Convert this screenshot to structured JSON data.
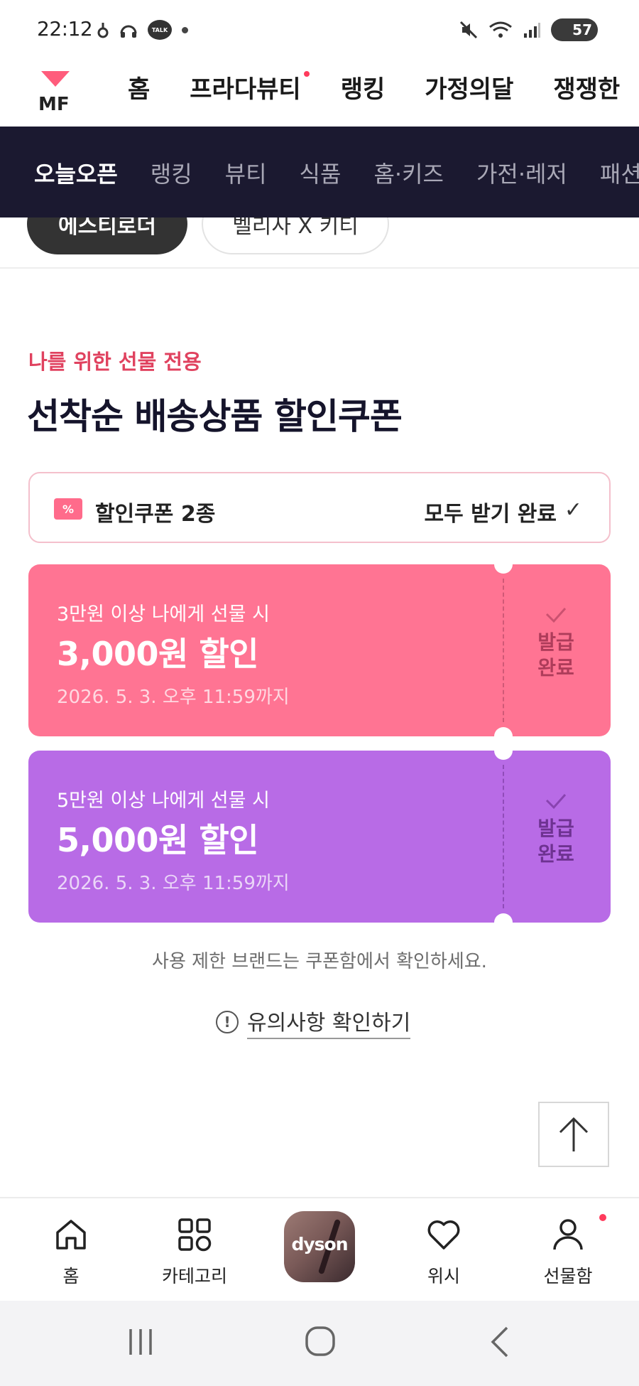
{
  "status_bar": {
    "time": "22:12",
    "talk_badge": "TALK",
    "battery": "57"
  },
  "top_nav": {
    "logo_text": "MF",
    "items": [
      {
        "label": "홈",
        "has_dot": false
      },
      {
        "label": "프라다뷰티",
        "has_dot": true
      },
      {
        "label": "랭킹",
        "has_dot": false
      },
      {
        "label": "가정의달",
        "has_dot": false
      },
      {
        "label": "쟁쟁한",
        "has_dot": false
      }
    ]
  },
  "category_bar": {
    "items": [
      "오늘오픈",
      "랭킹",
      "뷰티",
      "식품",
      "홈·키즈",
      "가전·레저",
      "패션"
    ],
    "active_index": 0
  },
  "chips": [
    "에스티로더",
    "벨리사 X 키티"
  ],
  "section": {
    "eyebrow": "나를 위한 선물 전용",
    "title": "선착순 배송상품 할인쿠폰"
  },
  "coupon_summary": {
    "icon_symbol": "%",
    "label": "할인쿠폰 2종",
    "status": "모두 받기 완료",
    "check": "✓"
  },
  "coupons": [
    {
      "condition": "3만원 이상 나에게 선물 시",
      "amount": "3,000원 할인",
      "expiry": "2026. 5. 3. 오후 11:59까지",
      "status_line1": "발급",
      "status_line2": "완료",
      "color": "#ff7493"
    },
    {
      "condition": "5만원 이상 나에게 선물 시",
      "amount": "5,000원 할인",
      "expiry": "2026. 5. 3. 오후 11:59까지",
      "status_line1": "발급",
      "status_line2": "완료",
      "color": "#b86be6"
    }
  ],
  "restrict_note": "사용 제한 브랜드는 쿠폰함에서 확인하세요.",
  "notice_link": "유의사항 확인하기",
  "tab_bar": {
    "items": [
      {
        "label": "홈",
        "icon": "home-icon"
      },
      {
        "label": "카테고리",
        "icon": "grid-icon"
      },
      {
        "label": "",
        "icon": "promo-banner"
      },
      {
        "label": "위시",
        "icon": "heart-icon"
      },
      {
        "label": "선물함",
        "icon": "person-icon"
      }
    ],
    "promo_text": "dyson"
  },
  "colors": {
    "accent_pink": "#ff7493",
    "accent_purple": "#b86be6",
    "dark_bar": "#1b1930",
    "eyebrow_red": "#e0425f"
  }
}
